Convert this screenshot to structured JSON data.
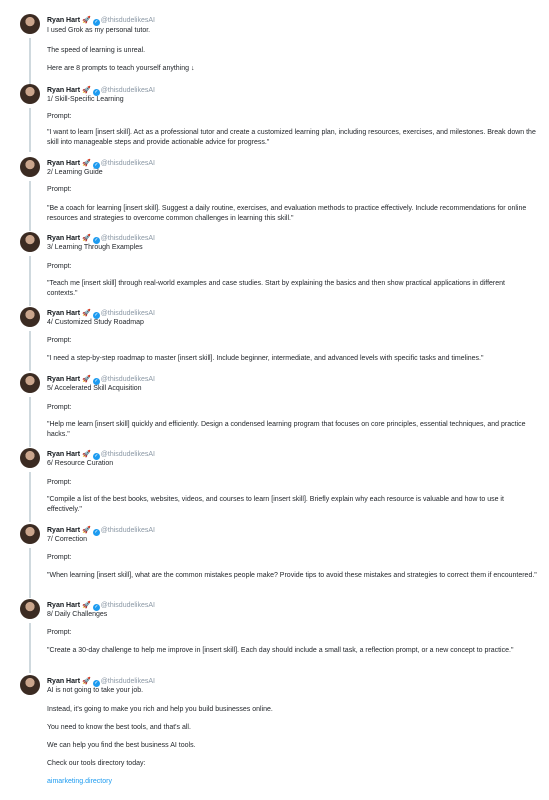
{
  "author": {
    "name": "Ryan Hart",
    "emoji": "🚀",
    "handle": "@thisdudelikesAI"
  },
  "prompt_label": "Prompt:",
  "intro": {
    "line1": "I used Grok as my personal tutor.",
    "line2": "The speed of learning is unreal.",
    "line3": "Here are 8 prompts to teach yourself anything ↓"
  },
  "tweets": [
    {
      "title": "1/ Skill-Specific Learning",
      "prompt": "\"I want to learn [insert skill]. Act as a professional tutor and create a customized learning plan, including resources, exercises, and milestones. Break down the skill into manageable steps and provide actionable advice for progress.\""
    },
    {
      "title": "2/ Learning Guide",
      "prompt": "\"Be a coach for learning [insert skill]. Suggest a daily routine, exercises, and evaluation methods to practice effectively. Include recommendations for online resources and strategies to overcome common challenges in learning this skill.\""
    },
    {
      "title": "3/ Learning Through Examples",
      "prompt": "\"Teach me [insert skill] through real-world examples and case studies. Start by explaining the basics and then show practical applications in different contexts.\""
    },
    {
      "title": "4/ Customized Study Roadmap",
      "prompt": "\"I need a step-by-step roadmap to master [insert skill]. Include beginner, intermediate, and advanced levels with specific tasks and timelines.\""
    },
    {
      "title": "5/ Accelerated Skill Acquisition",
      "prompt": "\"Help me learn [insert skill] quickly and efficiently. Design a condensed learning program that focuses on core principles, essential techniques, and practice hacks.\""
    },
    {
      "title": "6/ Resource Curation",
      "prompt": "\"Compile a list of the best books, websites, videos, and courses to learn [insert skill]. Briefly explain why each resource is valuable and how to use it effectively.\""
    },
    {
      "title": "7/ Correction",
      "prompt": "\"When learning [insert skill], what are the common mistakes people make? Provide tips to avoid these mistakes and strategies to correct them if encountered.\""
    },
    {
      "title": "8/ Daily Challenges",
      "prompt": "\"Create a 30-day challenge to help me improve in [insert skill]. Each day should include a small task, a reflection prompt, or a new concept to practice.\""
    }
  ],
  "outro": {
    "line1": "AI is not going to take your job.",
    "line2": "Instead, it's going to make you rich and help you build businesses online.",
    "line3": "You need to know the best tools, and that's all.",
    "line4": "We can help you find the best business AI tools.",
    "line5": "Check our tools directory today:",
    "link": "aimarketing.directory"
  }
}
